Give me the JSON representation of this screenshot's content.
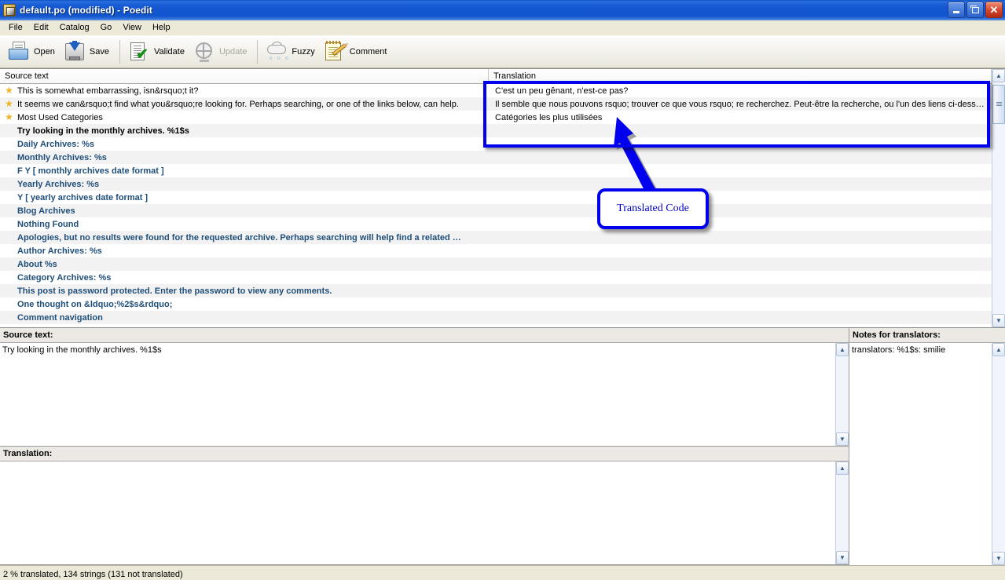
{
  "window": {
    "title": "default.po (modified) - Poedit",
    "icon": "poedit-app-icon",
    "controls": {
      "minimize": "minimize-icon",
      "maximize": "restore-icon",
      "close": "close-icon"
    }
  },
  "menu": {
    "items": [
      "File",
      "Edit",
      "Catalog",
      "Go",
      "View",
      "Help"
    ]
  },
  "toolbar": {
    "buttons": [
      {
        "label": "Open",
        "icon": "open-folder-icon",
        "disabled": false
      },
      {
        "label": "Save",
        "icon": "save-disk-icon",
        "disabled": false
      },
      {
        "label": "Validate",
        "icon": "validate-check-icon",
        "disabled": false
      },
      {
        "label": "Update",
        "icon": "update-globe-icon",
        "disabled": true
      },
      {
        "label": "Fuzzy",
        "icon": "fuzzy-cloud-icon",
        "disabled": false
      },
      {
        "label": "Comment",
        "icon": "comment-notepad-icon",
        "disabled": false
      }
    ]
  },
  "list": {
    "columns": [
      {
        "key": "source",
        "label": "Source text"
      },
      {
        "key": "translation",
        "label": "Translation"
      }
    ],
    "rows": [
      {
        "source": "This is somewhat embarrassing, isn&rsquo;t it?",
        "translation": "C'est un peu gênant, n'est-ce pas?",
        "state": "translated",
        "star": true
      },
      {
        "source": "It seems we can&rsquo;t find what you&rsquo;re looking for. Perhaps searching, or one of the links below, can help.",
        "translation": "Il semble que nous pouvons rsquo; trouver ce que vous rsquo; re recherchez. Peut-être la recherche, ou l'un des liens ci-dess…",
        "state": "translated",
        "star": true
      },
      {
        "source": "Most Used Categories",
        "translation": "Catégories les plus utilisées",
        "state": "translated",
        "star": true
      },
      {
        "source": "Try looking in the monthly archives. %1$s",
        "translation": "",
        "state": "selected",
        "star": false
      },
      {
        "source": "Daily Archives: %s",
        "translation": "",
        "state": "untranslated",
        "star": false
      },
      {
        "source": "Monthly Archives: %s",
        "translation": "",
        "state": "untranslated",
        "star": false
      },
      {
        "source": "F Y  [ monthly archives date format ]",
        "translation": "",
        "state": "untranslated",
        "star": false
      },
      {
        "source": "Yearly Archives: %s",
        "translation": "",
        "state": "untranslated",
        "star": false
      },
      {
        "source": "Y  [ yearly archives date format ]",
        "translation": "",
        "state": "untranslated",
        "star": false
      },
      {
        "source": "Blog Archives",
        "translation": "",
        "state": "untranslated",
        "star": false
      },
      {
        "source": "Nothing Found",
        "translation": "",
        "state": "untranslated",
        "star": false
      },
      {
        "source": "Apologies, but no results were found for the requested archive. Perhaps searching will help find a related …",
        "translation": "",
        "state": "untranslated",
        "star": false
      },
      {
        "source": "Author Archives: %s",
        "translation": "",
        "state": "untranslated",
        "star": false
      },
      {
        "source": "About %s",
        "translation": "",
        "state": "untranslated",
        "star": false
      },
      {
        "source": "Category Archives: %s",
        "translation": "",
        "state": "untranslated",
        "star": false
      },
      {
        "source": "This post is password protected. Enter the password to view any comments.",
        "translation": "",
        "state": "untranslated",
        "star": false
      },
      {
        "source": "One thought on &ldquo;%2$s&rdquo;",
        "translation": "",
        "state": "untranslated",
        "star": false
      },
      {
        "source": "Comment navigation",
        "translation": "",
        "state": "untranslated",
        "star": false
      }
    ]
  },
  "panes": {
    "source": {
      "label": "Source text:",
      "value": "Try looking in the monthly archives. %1$s"
    },
    "translation": {
      "label": "Translation:",
      "value": ""
    },
    "notes": {
      "label": "Notes for translators:",
      "value": "translators: %1$s: smilie"
    }
  },
  "statusbar": {
    "text": "2 % translated, 134 strings (131 not translated)"
  },
  "annotations": {
    "callout_label": "Translated Code",
    "color": "#0000ee"
  }
}
